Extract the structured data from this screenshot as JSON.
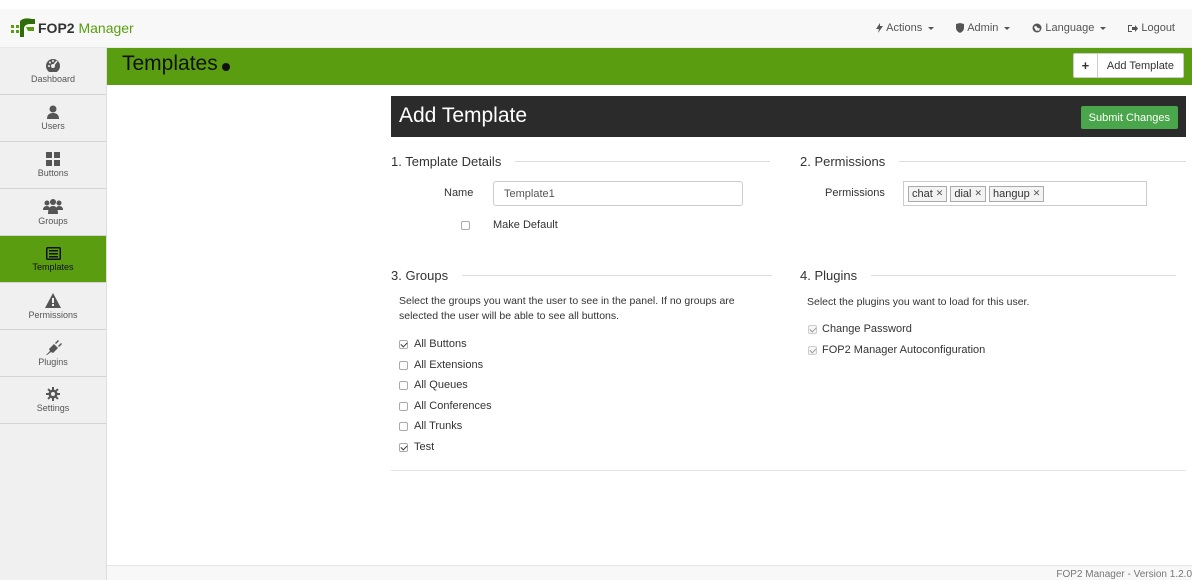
{
  "brand": {
    "name_bold": "FOP2",
    "name_light": " Manager"
  },
  "nav": {
    "actions": "Actions",
    "admin": "Admin",
    "language": "Language",
    "logout": "Logout"
  },
  "sidebar": {
    "items": [
      {
        "label": "Dashboard",
        "icon": "dashboard-icon"
      },
      {
        "label": "Users",
        "icon": "user-icon"
      },
      {
        "label": "Buttons",
        "icon": "grid-icon"
      },
      {
        "label": "Groups",
        "icon": "group-icon"
      },
      {
        "label": "Templates",
        "icon": "list-icon",
        "active": true
      },
      {
        "label": "Permissions",
        "icon": "warning-icon"
      },
      {
        "label": "Plugins",
        "icon": "plug-icon"
      },
      {
        "label": "Settings",
        "icon": "gear-icon"
      }
    ]
  },
  "page": {
    "title": "Templates",
    "add_button": "Add Template"
  },
  "panel": {
    "title": "Add Template",
    "submit": "Submit Changes",
    "details": {
      "heading": "1. Template Details",
      "name_label": "Name",
      "name_value": "Template1",
      "default_label": "Make Default",
      "default_checked": false
    },
    "permissions": {
      "heading": "2. Permissions",
      "label": "Permissions",
      "tags": [
        "chat",
        "dial",
        "hangup"
      ]
    },
    "groups": {
      "heading": "3. Groups",
      "desc_line1": "Select the groups you want the user to see in the panel. If no groups are",
      "desc_line2": "selected the user will be able to see all buttons.",
      "items": [
        {
          "label": "All Buttons",
          "checked": true
        },
        {
          "label": "All Extensions",
          "checked": false
        },
        {
          "label": "All Queues",
          "checked": false
        },
        {
          "label": "All Conferences",
          "checked": false
        },
        {
          "label": "All Trunks",
          "checked": false
        },
        {
          "label": "Test",
          "checked": true
        }
      ]
    },
    "plugins": {
      "heading": "4. Plugins",
      "desc": "Select the plugins you want to load for this user.",
      "items": [
        {
          "label": "Change Password",
          "checked": true
        },
        {
          "label": "FOP2 Manager Autoconfiguration",
          "checked": true
        }
      ]
    }
  },
  "footer": {
    "text": "FOP2 Manager - Version 1.2.0"
  },
  "colors": {
    "brand_green": "#5a9d10",
    "submit_green": "#4aa64a",
    "panel_dark": "#2b2b2b"
  }
}
